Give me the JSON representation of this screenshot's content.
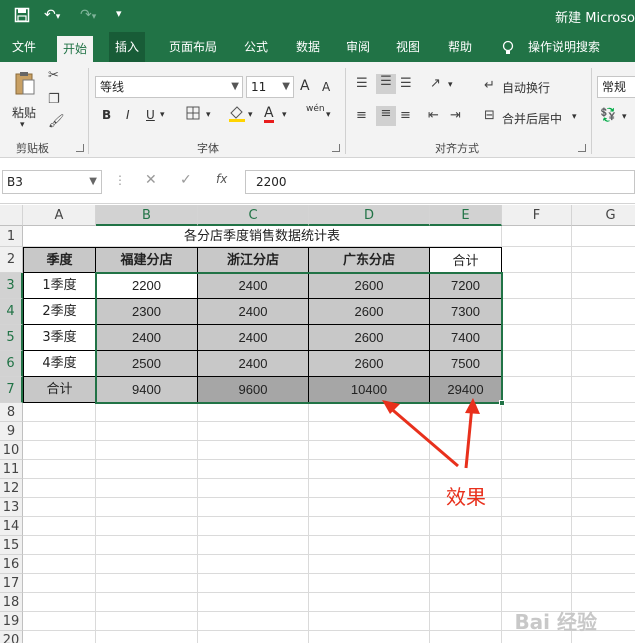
{
  "titlebar": {
    "title": "新建 Microso"
  },
  "tabs": [
    "文件",
    "开始",
    "插入",
    "页面布局",
    "公式",
    "数据",
    "审阅",
    "视图",
    "帮助",
    "操作说明搜索"
  ],
  "ribbon": {
    "clipboard": {
      "paste": "粘贴",
      "group": "剪贴板"
    },
    "font": {
      "name": "等线",
      "size": "11",
      "group": "字体",
      "bold": "B",
      "italic": "I",
      "underline": "U",
      "grow": "A",
      "shrink": "A",
      "font_color": "A",
      "phonetic": "wén"
    },
    "alignment": {
      "wrap": "自动换行",
      "merge": "合并后居中",
      "group": "对齐方式"
    },
    "number": {
      "format": "常规"
    }
  },
  "formula_bar": {
    "name_box": "B3",
    "fx": "fx",
    "value": "2200"
  },
  "columns": [
    "A",
    "B",
    "C",
    "D",
    "E",
    "F",
    "G"
  ],
  "rows": [
    "1",
    "2",
    "3",
    "4",
    "5",
    "6",
    "7",
    "8",
    "9",
    "10",
    "11",
    "12",
    "13",
    "14",
    "15",
    "16",
    "17",
    "18",
    "19",
    "20"
  ],
  "sheet": {
    "title": "各分店季度销售数据统计表",
    "headers": [
      "季度",
      "福建分店",
      "浙江分店",
      "广东分店",
      "合计"
    ],
    "data": [
      [
        "1季度",
        "2200",
        "2400",
        "2600",
        "7200"
      ],
      [
        "2季度",
        "2300",
        "2400",
        "2600",
        "7300"
      ],
      [
        "3季度",
        "2400",
        "2400",
        "2600",
        "7400"
      ],
      [
        "4季度",
        "2500",
        "2400",
        "2600",
        "7500"
      ],
      [
        "合计",
        "9400",
        "9600",
        "10400",
        "29400"
      ]
    ]
  },
  "annotation": "效果",
  "watermark": "Bai 经验",
  "colors": {
    "accent": "#217346",
    "highlight": "#c8c8c8",
    "highlight_dark": "#a6a6a6",
    "annotation": "#e8301c"
  }
}
